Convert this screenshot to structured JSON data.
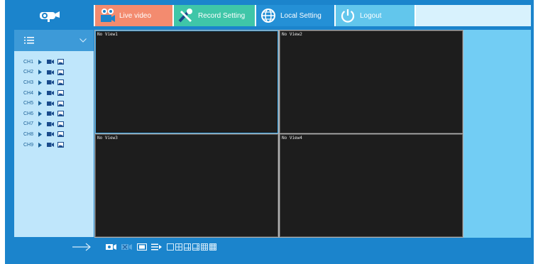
{
  "nav": {
    "tabs": [
      {
        "label": "Live video",
        "icon": "video-camera-icon"
      },
      {
        "label": "Record Setting",
        "icon": "tools-icon"
      },
      {
        "label": "Local Setting",
        "icon": "globe-icon"
      },
      {
        "label": "Logout",
        "icon": "power-icon"
      }
    ]
  },
  "sidebar": {
    "channels": [
      "CH1",
      "CH2",
      "CH3",
      "CH4",
      "CH5",
      "CH6",
      "CH7",
      "CH8",
      "CH9"
    ]
  },
  "views": [
    {
      "label": "No View1",
      "selected": true
    },
    {
      "label": "No View2",
      "selected": false
    },
    {
      "label": "No View3",
      "selected": false
    },
    {
      "label": "No View4",
      "selected": false
    }
  ],
  "colors": {
    "frame": "#1b84cc",
    "live_tab": "#f38b6f",
    "record_tab": "#3fc6a8",
    "local_tab": "#2490d6",
    "logout_tab": "#62c6ec"
  }
}
